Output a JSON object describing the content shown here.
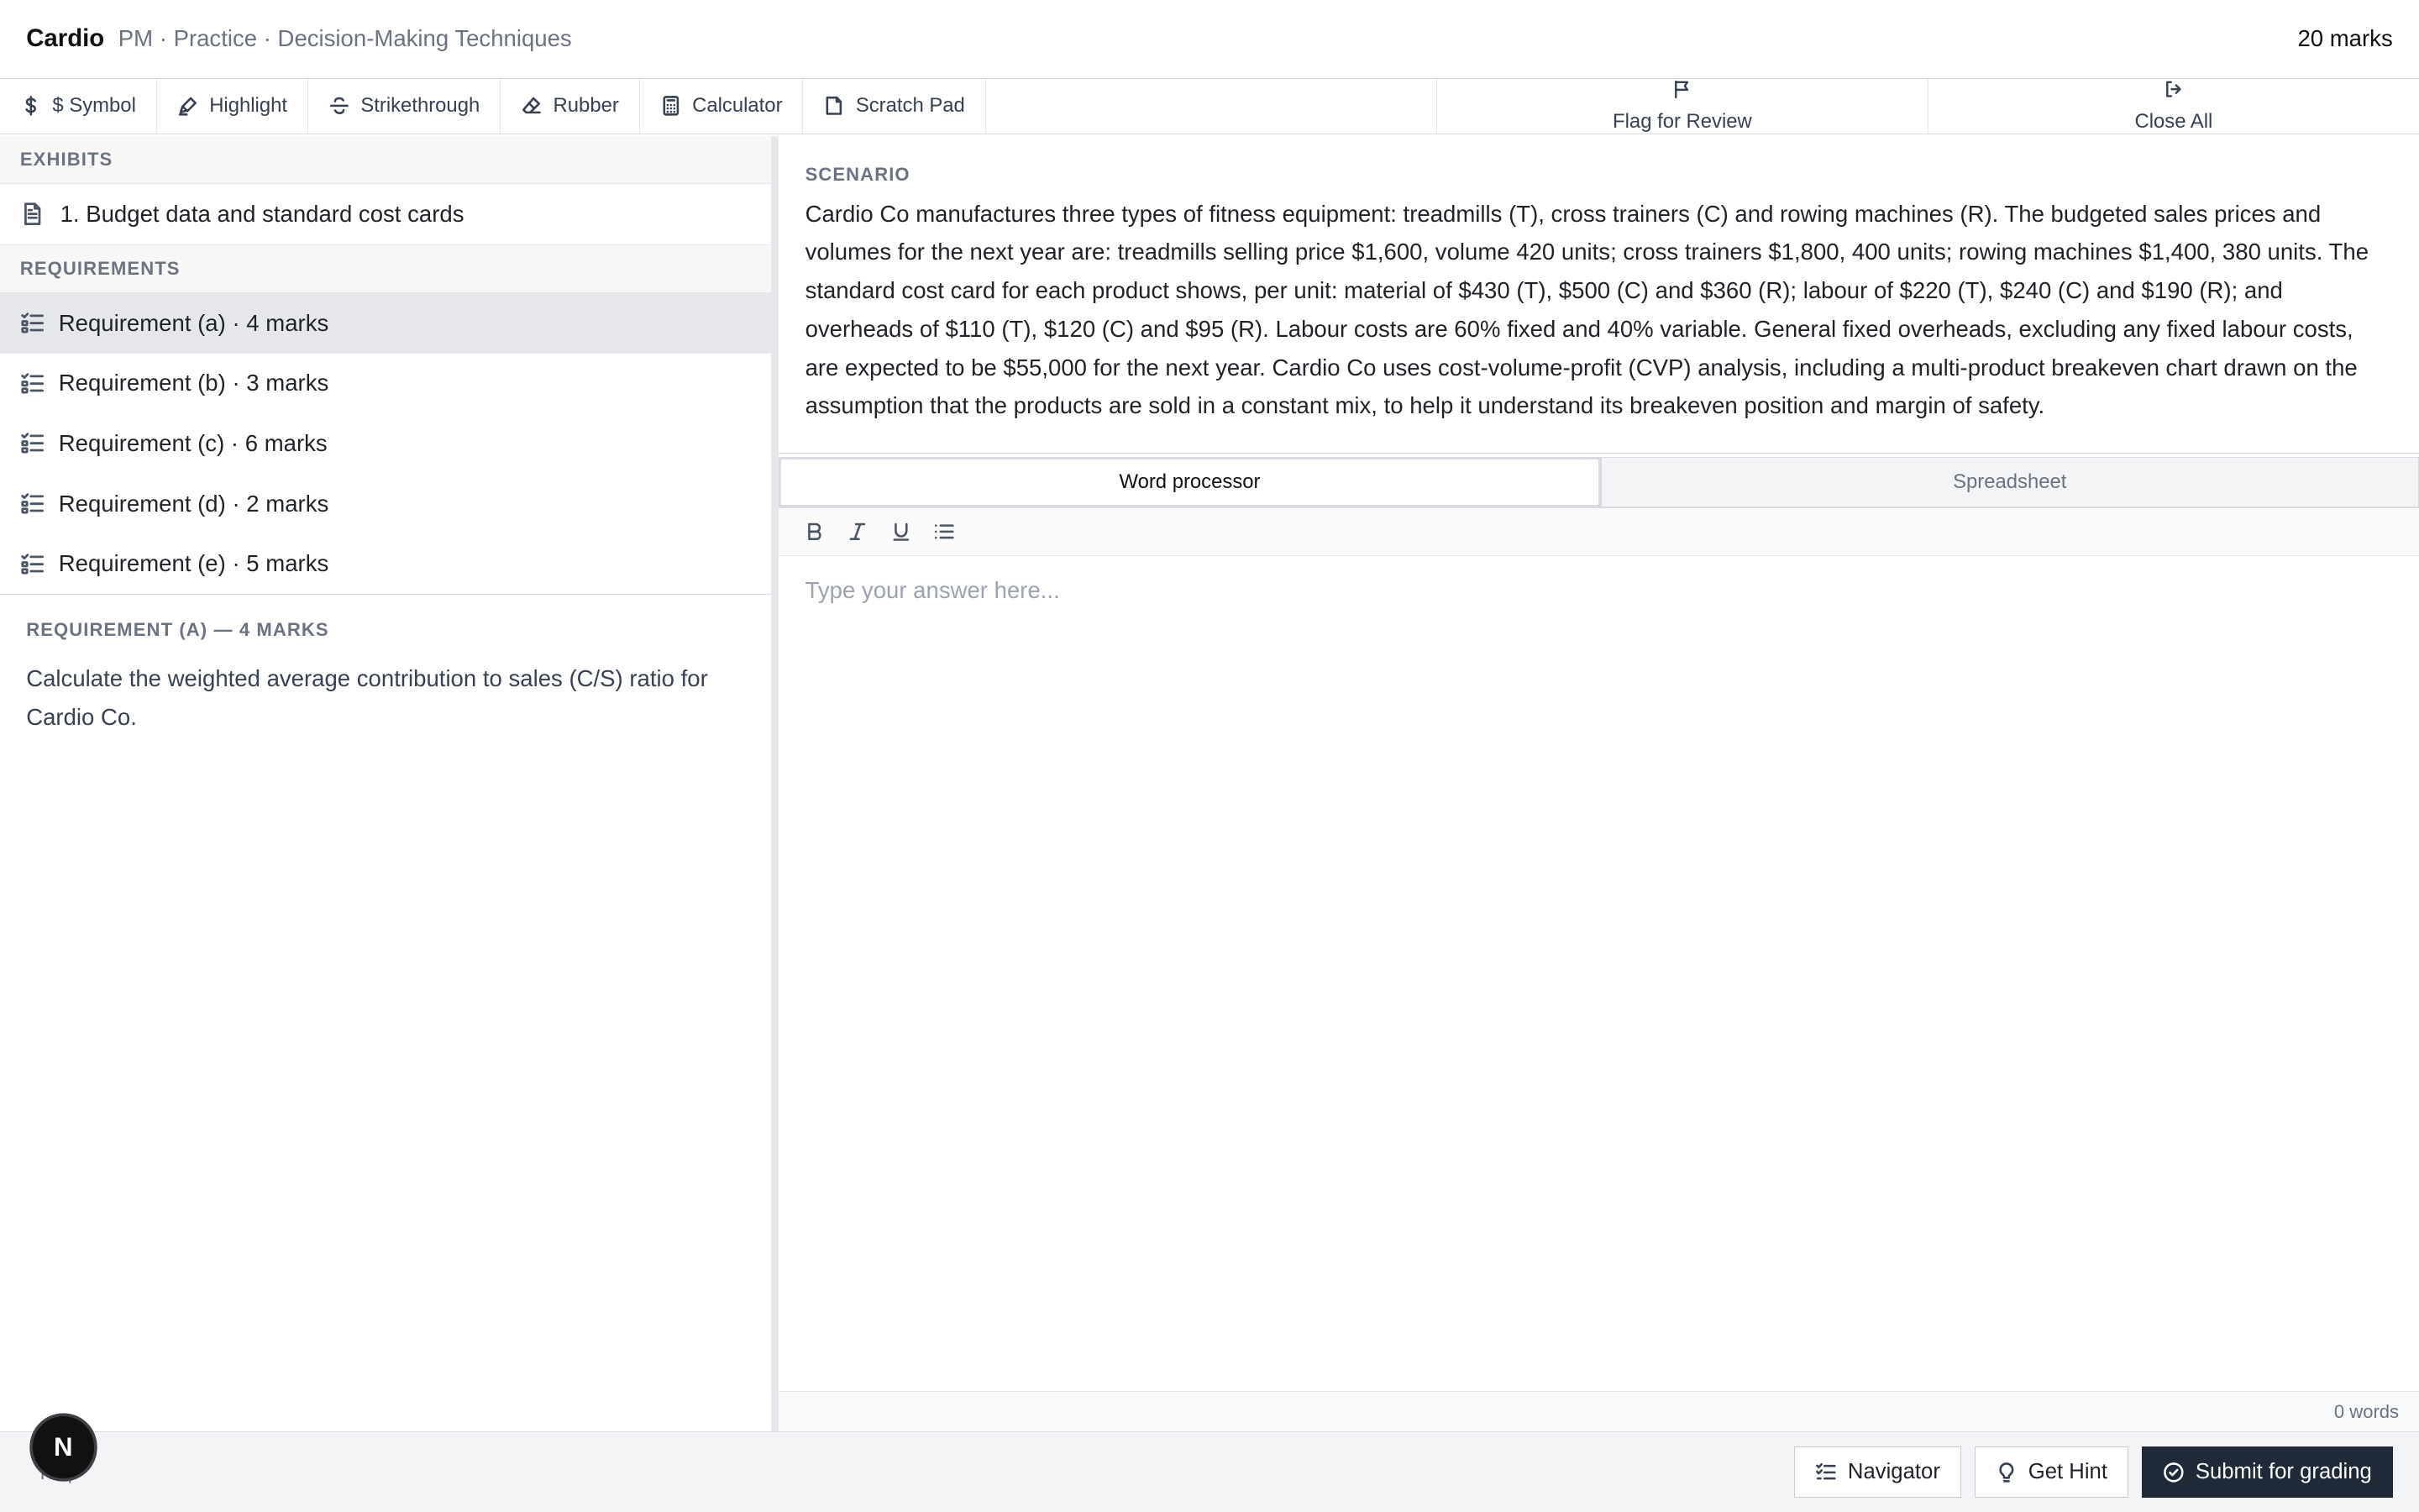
{
  "header": {
    "brand": "Cardio",
    "breadcrumb": "PM · Practice · Decision-Making Techniques",
    "total_marks": "20 marks"
  },
  "toolbar": {
    "tools": [
      {
        "label": "$ Symbol",
        "icon": "dollar-icon"
      },
      {
        "label": "Highlight",
        "icon": "highlighter-icon"
      },
      {
        "label": "Strikethrough",
        "icon": "strikethrough-icon"
      },
      {
        "label": "Rubber",
        "icon": "eraser-icon"
      },
      {
        "label": "Calculator",
        "icon": "calculator-icon"
      },
      {
        "label": "Scratch Pad",
        "icon": "note-icon"
      }
    ],
    "flag_label": "Flag for Review",
    "close_label": "Close All"
  },
  "sidebar": {
    "exhibits_heading": "EXHIBITS",
    "exhibits": [
      {
        "label": "1. Budget data and standard cost cards",
        "icon": "document-icon"
      }
    ],
    "requirements_heading": "REQUIREMENTS",
    "requirements": [
      {
        "label": "Requirement (a) · 4 marks",
        "active": true
      },
      {
        "label": "Requirement (b) · 3 marks",
        "active": false
      },
      {
        "label": "Requirement (c) · 6 marks",
        "active": false
      },
      {
        "label": "Requirement (d) · 2 marks",
        "active": false
      },
      {
        "label": "Requirement (e) · 5 marks",
        "active": false
      }
    ],
    "detail": {
      "title": "REQUIREMENT (A) — 4 MARKS",
      "text": "Calculate the weighted average contribution to sales (C/S) ratio for Cardio Co."
    }
  },
  "scenario": {
    "label": "SCENARIO",
    "text": "Cardio Co manufactures three types of fitness equipment: treadmills (T), cross trainers (C) and rowing machines (R). The budgeted sales prices and volumes for the next year are: treadmills selling price $1,600, volume 420 units; cross trainers $1,800, 400 units; rowing machines $1,400, 380 units. The standard cost card for each product shows, per unit: material of $430 (T), $500 (C) and $360 (R); labour of $220 (T), $240 (C) and $190 (R); and overheads of $110 (T), $120 (C) and $95 (R). Labour costs are 60% fixed and 40% variable. General fixed overheads, excluding any fixed labour costs, are expected to be $55,000 for the next year. Cardio Co uses cost-volume-profit (CVP) analysis, including a multi-product breakeven chart drawn on the assumption that the products are sold in a constant mix, to help it understand its breakeven position and margin of safety."
  },
  "answer": {
    "tabs": [
      {
        "label": "Word processor",
        "active": true
      },
      {
        "label": "Spreadsheet",
        "active": false
      }
    ],
    "format_icons": [
      "bold-icon",
      "italic-icon",
      "underline-icon",
      "list-icon"
    ],
    "placeholder": "Type your answer here...",
    "value": "",
    "word_count": "0 words"
  },
  "footer": {
    "help_label": "Help",
    "avatar_initial": "N",
    "navigator_label": "Navigator",
    "hint_label": "Get Hint",
    "submit_label": "Submit for grading"
  }
}
